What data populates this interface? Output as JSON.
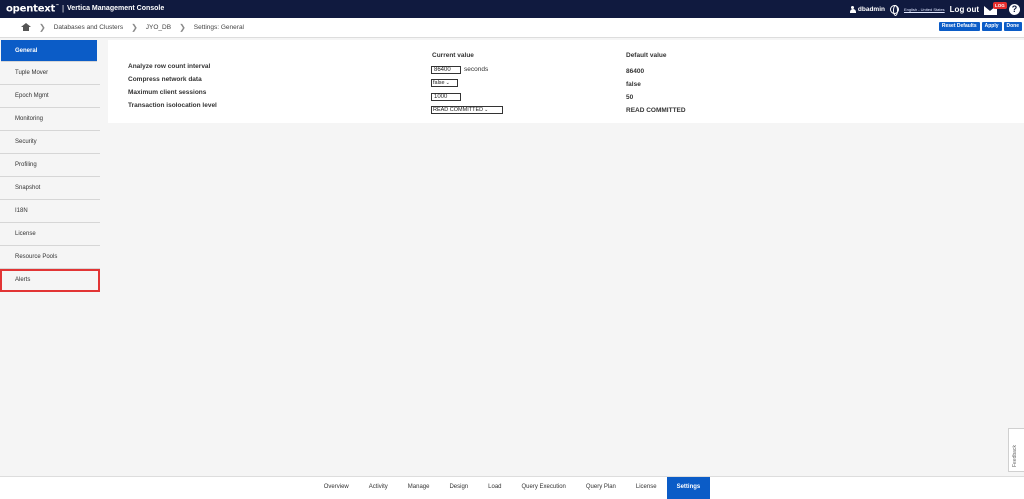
{
  "header": {
    "brand": "opentext",
    "trademark": "™",
    "separator": "|",
    "app_title": "Vertica Management Console",
    "user": "dbadmin",
    "language": "English - United States",
    "logout": "Log out",
    "message_badge": "LOG",
    "help": "?"
  },
  "breadcrumb": {
    "items": [
      "Databases and Clusters",
      "JYO_DB",
      "Settings: General"
    ]
  },
  "actions": {
    "reset_defaults": "Reset Defaults",
    "apply": "Apply",
    "done": "Done"
  },
  "sidebar": {
    "items": [
      {
        "label": "General",
        "active": true
      },
      {
        "label": "Tuple Mover"
      },
      {
        "label": "Epoch Mgmt"
      },
      {
        "label": "Monitoring"
      },
      {
        "label": "Security"
      },
      {
        "label": "Profiling"
      },
      {
        "label": "Snapshot"
      },
      {
        "label": "I18N"
      },
      {
        "label": "License"
      },
      {
        "label": "Resource Pools"
      },
      {
        "label": "Alerts",
        "highlighted": true
      }
    ]
  },
  "settings": {
    "current_header": "Current value",
    "default_header": "Default value",
    "rows": [
      {
        "label": "Analyze row count interval",
        "current": "86400",
        "unit": "seconds",
        "default": "86400"
      },
      {
        "label": "Compress network data",
        "current": "false",
        "default": "false"
      },
      {
        "label": "Maximum client sessions",
        "current": "1000",
        "default": "50"
      },
      {
        "label": "Transaction isolocation level",
        "current": "READ COMMITTED",
        "default": "READ COMMITTED"
      }
    ]
  },
  "feedback": "Feedback",
  "bottom_nav": {
    "tabs": [
      "Overview",
      "Activity",
      "Manage",
      "Design",
      "Load",
      "Query Execution",
      "Query Plan",
      "License",
      "Settings"
    ],
    "active": "Settings"
  },
  "colors": {
    "topbar": "#101a3f",
    "accent": "#0b5cc7",
    "highlight": "#e23535"
  }
}
